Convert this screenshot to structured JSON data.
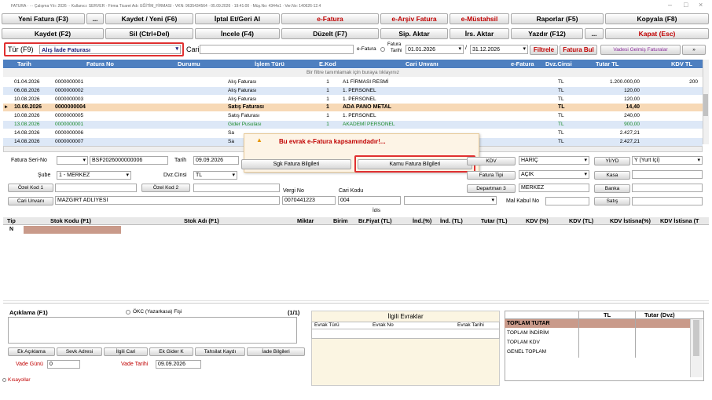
{
  "window": {
    "title": "FATURA · ··· Çalışma Yılı: 2026 ·· Kullanıcı: SERVER · Firma Ticaret Adı: EĞİTİM_FİRMASI · VKN: 9635434564 · 05.09.2026 · 19:41:00 · Müş.No: 4344x1 · Ver.No: 140626-12.4",
    "controls": [
      "–",
      "□",
      "×"
    ]
  },
  "toolbar": {
    "row1": [
      "Yeni Fatura (F3)",
      "...",
      "Kaydet / Yeni (F6)",
      "İptal Et/Geri Al",
      "e-Fatura",
      "e-Arşiv Fatura",
      "e-Müstahsil",
      "Raporlar (F5)",
      "Kopyala (F8)"
    ],
    "row2": [
      "Kaydet (F2)",
      "Sil (Ctrl+Del)",
      "İncele (F4)",
      "Düzelt (F7)",
      "Sip. Aktar",
      "İrs. Aktar",
      "Yazdır (F12)",
      "...",
      "Kapat (Esc)"
    ]
  },
  "filter": {
    "tur_label": "Tür (F9)",
    "tur_value": "Alış İade Faturası",
    "cari_label": "Cari",
    "efatura_label": "e-Fatura",
    "fatura_tarihi_label1": "Fatura",
    "fatura_tarihi_label2": "Tarihi",
    "date_from": "01.01.2026",
    "date_sep": "/",
    "date_to": "31.12.2026",
    "filtrele": "Filtrele",
    "fatura_bul": "Fatura Bul",
    "vadesi": "Vadesi Gelmiş Faturalar",
    "extra": "»"
  },
  "grid": {
    "headers": [
      "Tarih",
      "Fatura No",
      "Durumu",
      "İşlem Türü",
      "E.Kod",
      "Cari Unvanı",
      "e-Fatura",
      "Dvz.Cinsi",
      "Tutar TL",
      "KDV TL"
    ],
    "hint": "Bir filtre tanımlamak için buraya tıklayınız",
    "rows": [
      {
        "tarih": "01.04.2026",
        "no": "0000000001",
        "durum": "",
        "islem": "Alış Faturası",
        "ekod": "1",
        "cari": "A1 FİRMASI RESMİ",
        "efat": "",
        "dvz": "TL",
        "tutar": "1.200.000,00",
        "kdv": "200",
        "style": "normal"
      },
      {
        "tarih": "06.08.2026",
        "no": "0000000002",
        "durum": "",
        "islem": "Alış Faturası",
        "ekod": "1",
        "cari": "1. PERSONEL",
        "efat": "",
        "dvz": "TL",
        "tutar": "120,00",
        "kdv": "",
        "style": "alt"
      },
      {
        "tarih": "10.08.2026",
        "no": "0000000003",
        "durum": "",
        "islem": "Alış Faturası",
        "ekod": "1",
        "cari": "1. PERSONEL",
        "efat": "",
        "dvz": "TL",
        "tutar": "120,00",
        "kdv": "",
        "style": "normal"
      },
      {
        "tarih": "10.08.2026",
        "no": "0000000004",
        "durum": "",
        "islem": "Satış Faturası",
        "ekod": "1",
        "cari": "ADA PANO METAL",
        "efat": "",
        "dvz": "TL",
        "tutar": "14,40",
        "kdv": "",
        "style": "selected"
      },
      {
        "tarih": "10.08.2026",
        "no": "0000000005",
        "durum": "",
        "islem": "Satış Faturası",
        "ekod": "1",
        "cari": "1. PERSONEL",
        "efat": "",
        "dvz": "TL",
        "tutar": "240,00",
        "kdv": "",
        "style": "normal"
      },
      {
        "tarih": "13.08.2026",
        "no": "0000000001",
        "durum": "",
        "islem": "Gider Pusulası",
        "ekod": "1",
        "cari": "AKADEMİ PERSONEL",
        "efat": "",
        "dvz": "TL",
        "tutar": "900,00",
        "kdv": "",
        "style": "green"
      },
      {
        "tarih": "14.08.2026",
        "no": "0000000006",
        "durum": "",
        "islem": "Sa",
        "ekod": "",
        "cari": "",
        "efat": "",
        "dvz": "TL",
        "tutar": "2.427,21",
        "kdv": "",
        "style": "normal"
      },
      {
        "tarih": "14.08.2026",
        "no": "0000000007",
        "durum": "",
        "islem": "Sa",
        "ekod": "",
        "cari": "",
        "efat": "",
        "dvz": "TL",
        "tutar": "2.427,21",
        "kdv": "",
        "style": "alt"
      }
    ]
  },
  "popup": {
    "message": "Bu evrak e-Fatura kapsamındadır!...",
    "sgk_button": "Sgk Fatura Bilgileri",
    "kamu_button": "Kamu Fatura Bilgileri"
  },
  "form": {
    "seri_no_label": "Fatura Seri-No",
    "seri_no_value": "BSF2026000000006",
    "tarih_label": "Tarih",
    "tarih_value": "09.09.2026",
    "sube_label": "Şube",
    "sube_value": "1 - MERKEZ",
    "dvz_label": "Dvz.Cinsi",
    "dvz_value": "TL",
    "ozel1": "Özel Kod 1",
    "ozel2": "Özel Kod 2",
    "cari_unvani_btn": "Cari Unvanı",
    "cari_unvani_value": "MAZGİRT ADLİYESİ",
    "vergi_no_label": "Vergi No",
    "vergi_no_value": "0070441223",
    "cari_kodu_label": "Cari Kodu",
    "cari_kodu_value": "004",
    "kdv_btn": "KDV",
    "kdv_value": "HARİÇ",
    "yiyd_btn": "Yİ/YD",
    "yiyd_value": "Y (Yurt İçi)",
    "fatura_tipi_btn": "Fatura Tipi",
    "fatura_tipi_value": "AÇIK",
    "kasa_btn": "Kasa",
    "departman_btn": "Departman 3",
    "departman_value": "MERKEZ",
    "banka_btn": "Banka",
    "mal_kabul_label": "Mal Kabul No",
    "satis_btn": "Satış",
    "idis_label": "İdis"
  },
  "detail": {
    "headers": [
      "Tip",
      "Stok Kodu (F1)",
      "Stok Adı (F1)",
      "Miktar",
      "Birim",
      "Br.Fiyat (TL)",
      "İnd.(%)",
      "İnd. (TL)",
      "Tutar (TL)",
      "KDV (%)",
      "KDV (TL)",
      "KDV İstisna(%)",
      "KDV İstisna (T"
    ],
    "first_tip": "N"
  },
  "bottom": {
    "aciklama_label": "Açıklama (F1)",
    "okc_label": "ÖKC (Yazarkasa) Fişi",
    "page": "(1/1)",
    "buttons": [
      "Ek Açıklama",
      "Sevk Adresi",
      "İlgili Cari",
      "Ek Gider K",
      "Tahsilat Kaydı",
      "İade Bilgileri"
    ],
    "vade_gunu_label": "Vade Günü",
    "vade_gunu_value": "0",
    "vade_tarihi_label": "Vade Tarihi",
    "vade_tarihi_value": "09.09.2026",
    "kisayollar": "Kısayollar"
  },
  "ilgili": {
    "title": "İlgili Evraklar",
    "headers": [
      "Evrak Türü",
      "Evrak No",
      "Evrak Tarihi"
    ]
  },
  "totals": {
    "headers": [
      "",
      "TL",
      "Tutar (Dvz)"
    ],
    "rows": [
      "TOPLAM TUTAR",
      "TOPLAM İNDİRİM",
      "TOPLAM KDV",
      "GENEL TOPLAM"
    ]
  },
  "colors": {
    "header_blue": "#4d7fc0",
    "selected_row": "#f7d9b6",
    "alt_row": "#dde8f7",
    "red": "#c00000",
    "popup_bg": "#fdf4e6"
  }
}
